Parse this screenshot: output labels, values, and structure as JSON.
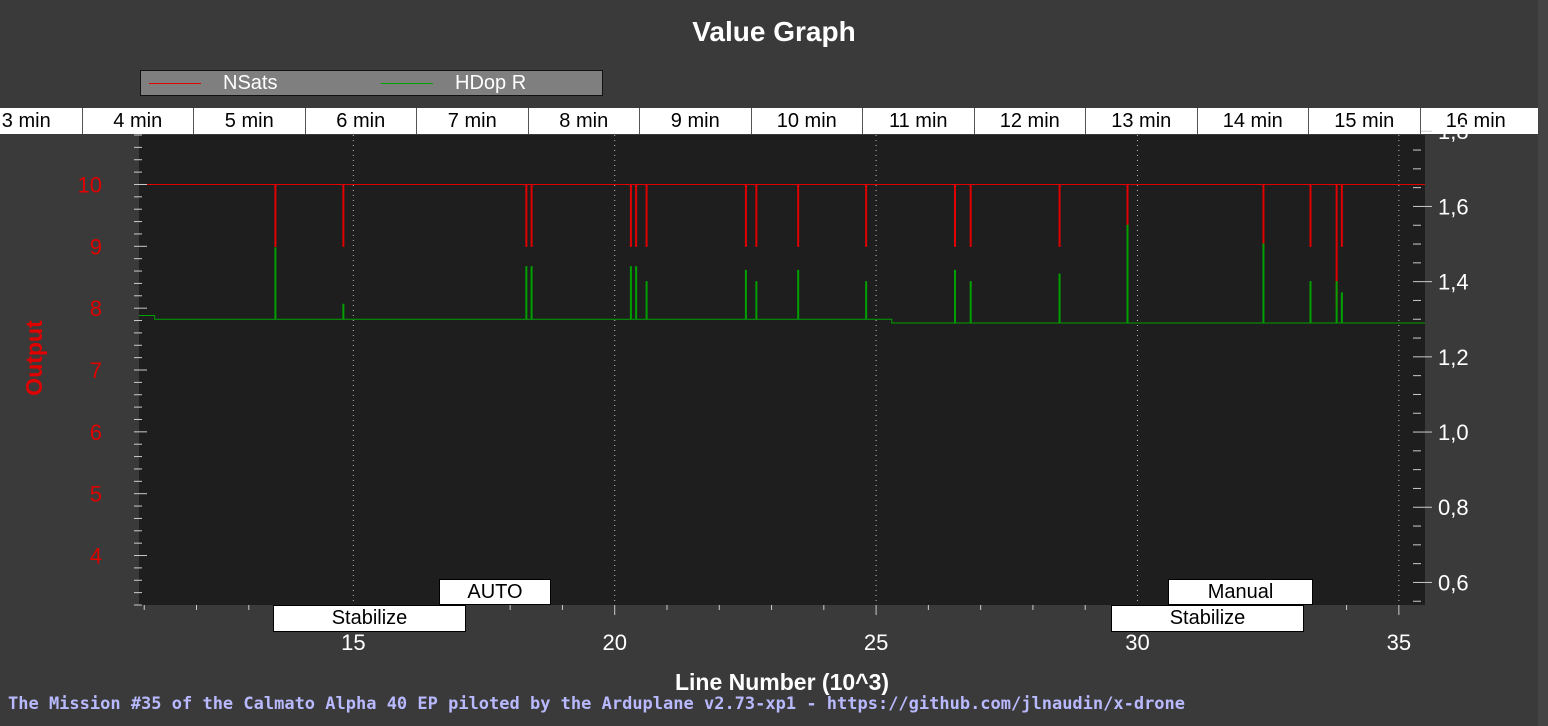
{
  "title": "Value Graph",
  "legend": [
    {
      "name": "NSats",
      "color": "#e00000"
    },
    {
      "name": "HDop R",
      "color": "#00a000"
    }
  ],
  "time_labels": [
    "3 min",
    "4 min",
    "5 min",
    "6 min",
    "7 min",
    "8 min",
    "9 min",
    "10 min",
    "11 min",
    "12 min",
    "13 min",
    "14 min",
    "15 min",
    "16 min"
  ],
  "modes_top": [
    {
      "label": "AUTO"
    },
    {
      "label": "Manual"
    }
  ],
  "modes_bottom": [
    {
      "label": "Stabilize"
    },
    {
      "label": "Stabilize"
    }
  ],
  "footer": "The Mission #35 of the Calmato Alpha 40 EP piloted by the Arduplane v2.73-xp1 - https://github.com/jlnaudin/x-drone",
  "chart_data": {
    "type": "line",
    "title": "Value Graph",
    "xlabel": "Line Number (10^3)",
    "ylabel": "Output",
    "xlim": [
      10.9,
      35.5
    ],
    "ylim": [
      3.2,
      10.8
    ],
    "y2lim": [
      0.54,
      1.79
    ],
    "x_ticks": [
      15,
      20,
      25,
      30,
      35
    ],
    "y_ticks": [
      4,
      5,
      6,
      7,
      8,
      9,
      10
    ],
    "y2_ticks": [
      "0,6",
      "0,8",
      "1,0",
      "1,2",
      "1,4",
      "1,6",
      "1,8"
    ],
    "y2_tick_values": [
      0.6,
      0.8,
      1.0,
      1.2,
      1.4,
      1.6,
      1.8
    ],
    "grid_x": [
      15,
      20,
      25,
      30,
      35
    ],
    "series": [
      {
        "name": "NSats",
        "axis": "left",
        "baseline": 10,
        "x_range": [
          10.9,
          35.5
        ],
        "dips": [
          [
            13.5,
            9
          ],
          [
            14.8,
            9
          ],
          [
            18.3,
            9
          ],
          [
            18.4,
            9
          ],
          [
            20.3,
            9
          ],
          [
            20.4,
            9
          ],
          [
            20.6,
            9
          ],
          [
            22.5,
            9
          ],
          [
            22.7,
            9
          ],
          [
            23.5,
            9
          ],
          [
            24.8,
            9
          ],
          [
            26.5,
            9
          ],
          [
            26.8,
            9
          ],
          [
            28.5,
            9
          ],
          [
            29.8,
            9
          ],
          [
            32.4,
            9
          ],
          [
            33.3,
            9
          ],
          [
            33.8,
            8
          ],
          [
            33.9,
            9
          ]
        ]
      },
      {
        "name": "HDop R",
        "axis": "right",
        "segments": [
          [
            10.9,
            1.31
          ],
          [
            11.2,
            1.3
          ],
          [
            25.3,
            1.29
          ],
          [
            35.5,
            1.29
          ]
        ],
        "spikes": [
          [
            13.5,
            1.49
          ],
          [
            14.8,
            1.34
          ],
          [
            18.3,
            1.44
          ],
          [
            18.4,
            1.44
          ],
          [
            20.3,
            1.44
          ],
          [
            20.4,
            1.44
          ],
          [
            20.6,
            1.4
          ],
          [
            22.5,
            1.43
          ],
          [
            22.7,
            1.4
          ],
          [
            23.5,
            1.43
          ],
          [
            24.8,
            1.4
          ],
          [
            26.5,
            1.43
          ],
          [
            26.8,
            1.4
          ],
          [
            28.5,
            1.42
          ],
          [
            29.8,
            1.55
          ],
          [
            32.4,
            1.5
          ],
          [
            33.3,
            1.4
          ],
          [
            33.8,
            1.4
          ],
          [
            33.9,
            1.37
          ]
        ]
      }
    ]
  }
}
